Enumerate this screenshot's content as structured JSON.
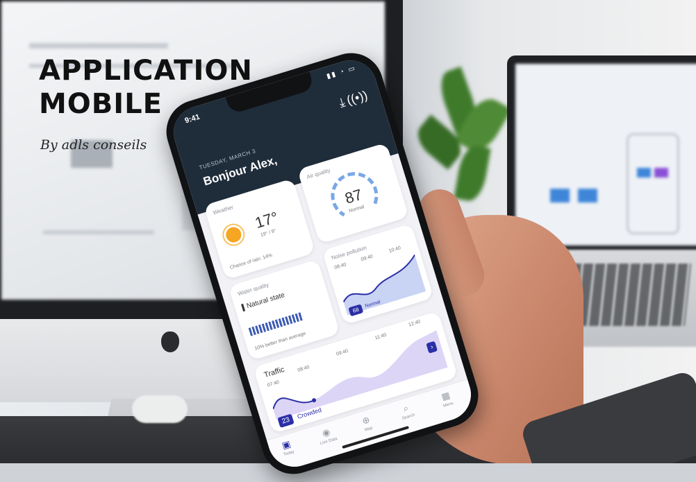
{
  "banner": {
    "title_line1": "APPLICATION",
    "title_line2": "MOBILE",
    "byline": "By adls conseils"
  },
  "phone": {
    "time": "9:41",
    "status": "▮▮ ◔ ▭",
    "date": "TUESDAY, MARCH 3",
    "greeting": "Bonjour Alex,",
    "weather": {
      "label": "Weather",
      "temp": "17°",
      "range": "19° / 9°",
      "note": "Chance of rain: 14%"
    },
    "air_quality": {
      "label": "Air quality",
      "value": "87",
      "status": "Normal"
    },
    "water_quality": {
      "label": "Water quality",
      "state": "Natural state",
      "note": "10% better than average"
    },
    "noise": {
      "label": "Noise pollution",
      "times": [
        "08:40",
        "09:40",
        "10:40"
      ],
      "value": "68",
      "status": "Normal"
    },
    "traffic": {
      "label": "Traffic",
      "times": [
        "07:40",
        "08:40",
        "09:40",
        "11:40",
        "12:40"
      ],
      "value": "23",
      "status": "Crowded",
      "next_glyph": "›"
    },
    "tabs": [
      {
        "label": "Today",
        "icon": "▣"
      },
      {
        "label": "Live Data",
        "icon": "◉"
      },
      {
        "label": "Map",
        "icon": "⊕"
      },
      {
        "label": "Search",
        "icon": "⌕"
      },
      {
        "label": "Menu",
        "icon": "▦"
      }
    ]
  }
}
